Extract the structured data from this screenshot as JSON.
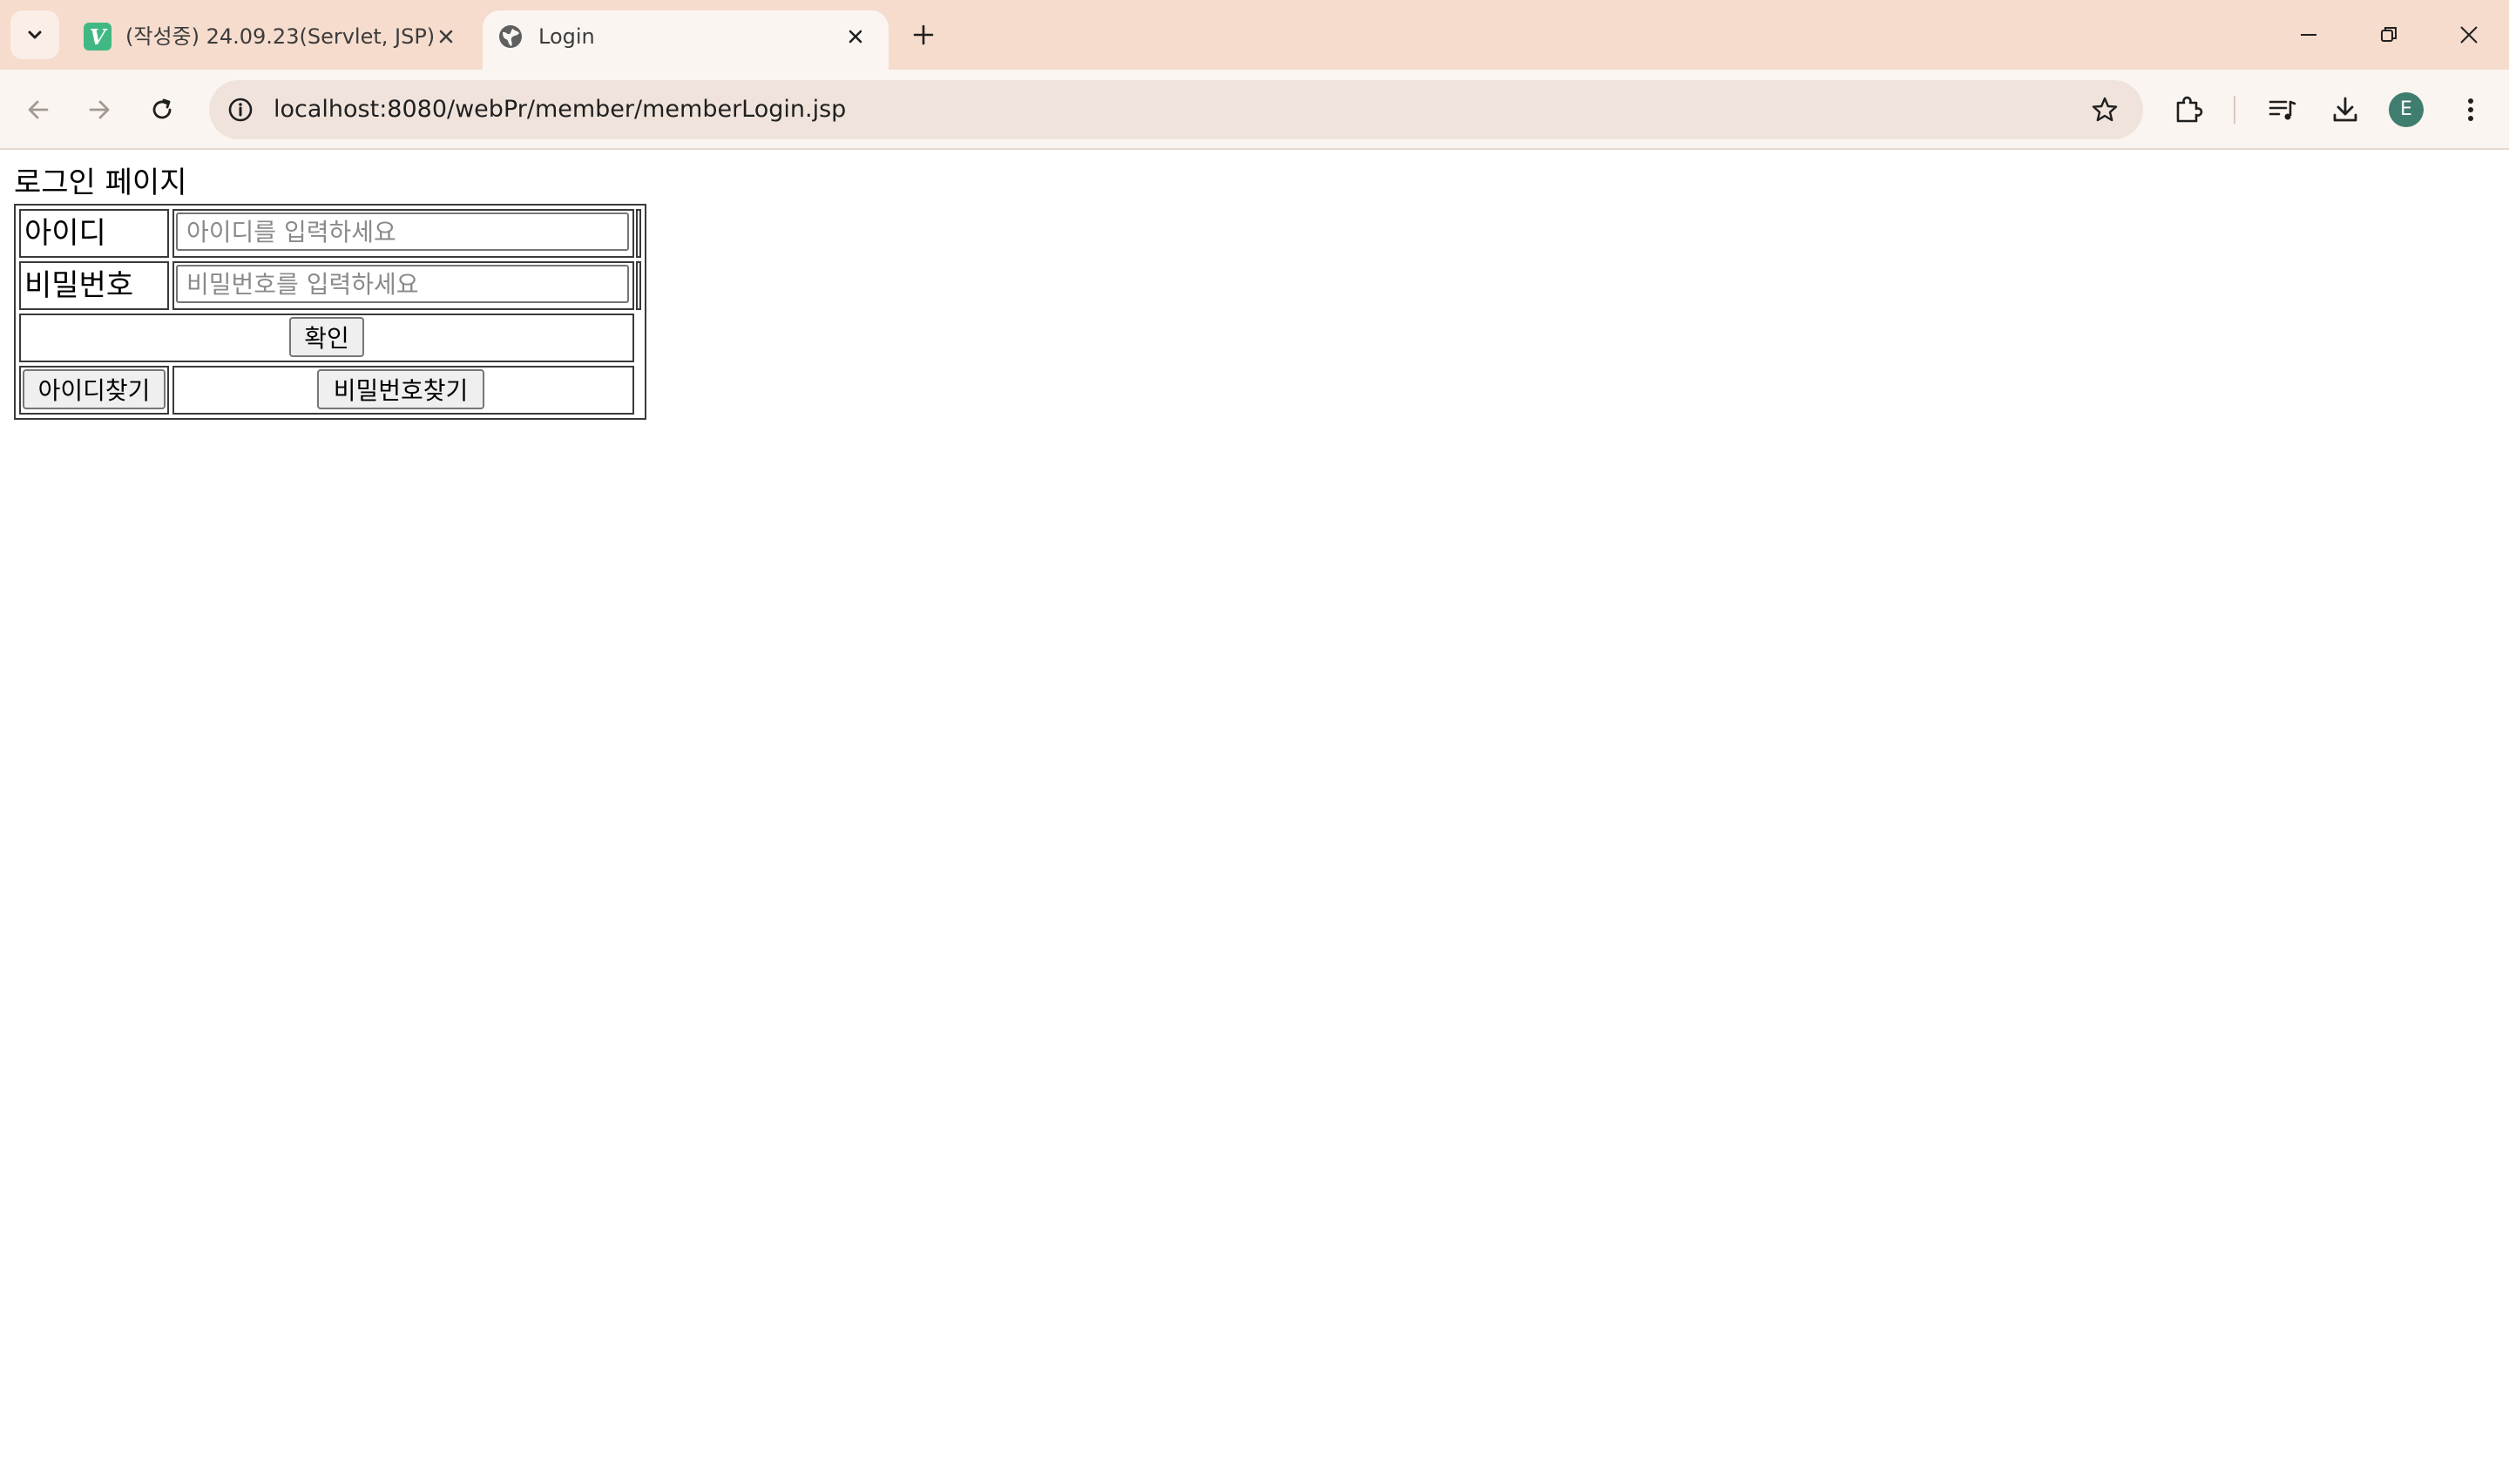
{
  "browser": {
    "tabs": [
      {
        "title": "(작성중) 24.09.23(Servlet, JSP)",
        "favicon": "V",
        "active": false
      },
      {
        "title": "Login",
        "active": true
      }
    ],
    "address_bar": {
      "url": "localhost:8080/webPr/member/memberLogin.jsp"
    },
    "profile_initial": "E",
    "colors": {
      "tabstrip_bg": "#f5dccd",
      "toolbar_bg": "#fbf5f1",
      "omnibox_bg": "#efe3dc",
      "favicon_green": "#41b883",
      "avatar_bg": "#3f7d6e"
    }
  },
  "page": {
    "heading": "로그인 페이지",
    "form": {
      "id_label": "아이디",
      "id_placeholder": "아이디를 입력하세요",
      "password_label": "비밀번호",
      "password_placeholder": "비밀번호를 입력하세요",
      "confirm_button": "확인",
      "find_id_button": "아이디찾기",
      "find_password_button": "비밀번호찾기"
    }
  }
}
